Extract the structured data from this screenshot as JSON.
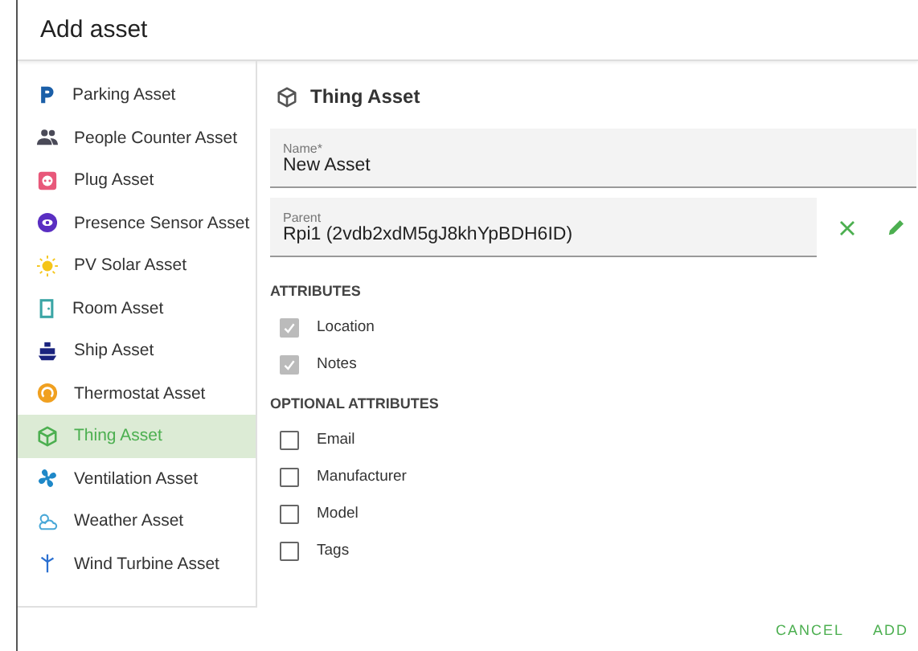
{
  "dialog": {
    "title": "Add asset"
  },
  "asset_types": [
    {
      "label": "Parking Asset",
      "color": "#1b5fa8",
      "selected": false
    },
    {
      "label": "People Counter Asset",
      "color": "#4a4a58",
      "selected": false
    },
    {
      "label": "Plug Asset",
      "color": "#e8587a",
      "selected": false
    },
    {
      "label": "Presence Sensor Asset",
      "color": "#5a2fc2",
      "selected": false
    },
    {
      "label": "PV Solar Asset",
      "color": "#f5c518",
      "selected": false
    },
    {
      "label": "Room Asset",
      "color": "#3aa5a5",
      "selected": false
    },
    {
      "label": "Ship Asset",
      "color": "#1a237e",
      "selected": false
    },
    {
      "label": "Thermostat Asset",
      "color": "#f0a020",
      "selected": false
    },
    {
      "label": "Thing Asset",
      "color": "#4caf50",
      "selected": true
    },
    {
      "label": "Ventilation Asset",
      "color": "#1e88c8",
      "selected": false
    },
    {
      "label": "Weather Asset",
      "color": "#49a8d8",
      "selected": false
    },
    {
      "label": "Wind Turbine Asset",
      "color": "#2a6fd0",
      "selected": false
    }
  ],
  "detail": {
    "title": "Thing Asset",
    "name_field": {
      "label": "Name*",
      "value": "New Asset"
    },
    "parent_field": {
      "label": "Parent",
      "value": "Rpi1 (2vdb2xdM5gJ8khYpBDH6ID)"
    },
    "attributes_heading": "ATTRIBUTES",
    "attributes": [
      {
        "label": "Location",
        "checked": true
      },
      {
        "label": "Notes",
        "checked": true
      }
    ],
    "optional_heading": "OPTIONAL ATTRIBUTES",
    "optional_attributes": [
      {
        "label": "Email",
        "checked": false
      },
      {
        "label": "Manufacturer",
        "checked": false
      },
      {
        "label": "Model",
        "checked": false
      },
      {
        "label": "Tags",
        "checked": false
      }
    ]
  },
  "buttons": [
    "CANCEL",
    "ADD"
  ]
}
